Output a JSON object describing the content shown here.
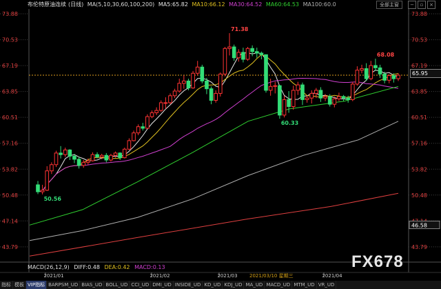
{
  "header": {
    "title": "布伦特原油连续",
    "period": "(日线)",
    "ma_label": "MA(5,10,30,60,100,200)",
    "ma5": "MA5:65.82",
    "ma10": "MA10:66.12",
    "ma30": "MA30:64.52",
    "ma60": "MA60:64.53",
    "ma100": "MA100:60.0",
    "mode_button": "全部主窗",
    "colors": {
      "ma5": "#e8e8e8",
      "ma10": "#e0c020",
      "ma30": "#d040d0",
      "ma60": "#30d030",
      "ma100": "#b0b0b0",
      "ma200": "#e04040"
    }
  },
  "price_tag": "65.95",
  "macd": {
    "label": "MACD(26,12,9)",
    "diff": "DIFF:0.48",
    "dea": "DEA:0.42",
    "macd": "MACD:0.13"
  },
  "cursor_date": "2021/03/10 星期三",
  "watermark": "FX678",
  "tabs": [
    "指标",
    "模板",
    "VIP指标",
    "BARPSM_UD",
    "BIAS_UD",
    "BOLL_UD",
    "CCI_UD",
    "DMI_UD",
    "INSIDE_UD",
    "KD_UD",
    "KDJ_UD",
    "MA_UD",
    "MACD_UD",
    "MTM_UD",
    "VR_UD"
  ],
  "chart_data": {
    "type": "candlestick",
    "symbol": "布伦特原油连续",
    "period": "日线",
    "y_ticks": [
      73.88,
      70.53,
      67.19,
      63.85,
      60.51,
      57.16,
      53.82,
      50.48,
      47.14,
      43.79
    ],
    "ylim": [
      42.0,
      74.5
    ],
    "x_labels": [
      "2021/01",
      "2021/02",
      "2021/03",
      "2021/04"
    ],
    "right_labels": [
      "65.95",
      "46.58"
    ],
    "annotations": [
      {
        "text": "71.38",
        "value": 71.38
      },
      {
        "text": "68.08",
        "value": 68.08
      },
      {
        "text": "60.33",
        "value": 60.33
      },
      {
        "text": "50.56",
        "value": 50.56
      }
    ],
    "candles": [
      [
        51.8,
        50.9,
        52.3,
        50.6
      ],
      [
        50.9,
        51.1,
        51.8,
        50.56
      ],
      [
        51.1,
        53.6,
        54.2,
        51.0
      ],
      [
        53.6,
        54.4,
        54.7,
        53.2
      ],
      [
        54.4,
        55.9,
        56.2,
        54.1
      ],
      [
        55.9,
        55.7,
        56.8,
        55.2
      ],
      [
        55.7,
        56.3,
        56.6,
        55.4
      ],
      [
        56.3,
        55.5,
        56.4,
        55.0
      ],
      [
        55.5,
        55.1,
        55.8,
        54.6
      ],
      [
        55.1,
        54.3,
        55.4,
        53.9
      ],
      [
        54.3,
        54.7,
        55.0,
        54.0
      ],
      [
        54.7,
        54.9,
        55.2,
        54.4
      ],
      [
        54.9,
        55.7,
        56.0,
        54.8
      ],
      [
        55.7,
        55.4,
        56.0,
        55.2
      ],
      [
        55.4,
        55.6,
        55.8,
        55.1
      ],
      [
        55.6,
        55.0,
        55.9,
        54.7
      ],
      [
        55.0,
        55.6,
        55.8,
        54.8
      ],
      [
        55.6,
        55.9,
        56.1,
        55.3
      ],
      [
        55.9,
        55.3,
        56.0,
        55.0
      ],
      [
        55.3,
        56.4,
        56.6,
        55.2
      ],
      [
        56.4,
        57.5,
        57.8,
        56.3
      ],
      [
        57.5,
        58.5,
        58.8,
        57.4
      ],
      [
        58.5,
        59.3,
        59.6,
        58.2
      ],
      [
        59.3,
        59.1,
        59.8,
        58.8
      ],
      [
        59.1,
        60.6,
        60.9,
        59.0
      ],
      [
        60.6,
        61.1,
        61.4,
        60.4
      ],
      [
        61.1,
        61.4,
        61.8,
        60.8
      ],
      [
        61.4,
        62.4,
        62.7,
        61.2
      ],
      [
        62.4,
        62.4,
        63.1,
        61.6
      ],
      [
        62.4,
        63.3,
        63.6,
        62.2
      ],
      [
        63.3,
        63.9,
        64.2,
        63.0
      ],
      [
        63.9,
        64.9,
        65.5,
        63.7
      ],
      [
        64.9,
        65.2,
        65.9,
        64.2
      ],
      [
        65.2,
        64.3,
        65.5,
        64.0
      ],
      [
        64.3,
        66.2,
        66.5,
        64.2
      ],
      [
        66.2,
        67.0,
        67.8,
        65.9
      ],
      [
        67.0,
        65.2,
        67.3,
        64.9
      ],
      [
        65.2,
        64.2,
        65.6,
        63.5
      ],
      [
        64.2,
        62.7,
        64.5,
        62.2
      ],
      [
        62.7,
        63.6,
        64.0,
        62.4
      ],
      [
        63.6,
        66.1,
        66.3,
        63.2
      ],
      [
        66.1,
        69.4,
        69.6,
        65.8
      ],
      [
        69.4,
        69.6,
        71.38,
        68.5
      ],
      [
        69.6,
        68.2,
        69.9,
        67.8
      ],
      [
        68.2,
        68.9,
        69.3,
        67.7
      ],
      [
        68.9,
        68.0,
        69.5,
        67.6
      ],
      [
        68.0,
        69.4,
        69.6,
        67.8
      ],
      [
        69.4,
        69.0,
        69.8,
        68.4
      ],
      [
        69.0,
        68.8,
        69.5,
        68.2
      ],
      [
        68.8,
        68.6,
        69.0,
        68.0
      ],
      [
        68.6,
        64.0,
        68.6,
        63.7
      ],
      [
        64.0,
        64.5,
        65.5,
        63.3
      ],
      [
        64.5,
        64.6,
        65.1,
        63.6
      ],
      [
        64.6,
        60.8,
        64.7,
        60.33
      ],
      [
        60.8,
        62.8,
        63.3,
        60.5
      ],
      [
        62.8,
        61.9,
        63.9,
        61.1
      ],
      [
        61.9,
        64.0,
        64.6,
        61.5
      ],
      [
        64.0,
        64.7,
        65.1,
        63.4
      ],
      [
        64.7,
        62.8,
        65.0,
        62.1
      ],
      [
        62.8,
        63.0,
        63.3,
        62.4
      ],
      [
        63.0,
        63.6,
        64.0,
        62.3
      ],
      [
        63.6,
        64.0,
        64.3,
        63.0
      ],
      [
        64.0,
        63.0,
        64.4,
        62.5
      ],
      [
        63.0,
        63.2,
        63.5,
        62.6
      ],
      [
        63.2,
        62.2,
        63.5,
        61.9
      ],
      [
        62.2,
        62.9,
        63.2,
        61.8
      ],
      [
        62.9,
        63.2,
        63.7,
        62.6
      ],
      [
        63.2,
        63.0,
        63.4,
        62.6
      ],
      [
        63.0,
        62.8,
        63.3,
        62.4
      ],
      [
        62.8,
        64.8,
        65.1,
        62.6
      ],
      [
        64.8,
        66.6,
        67.1,
        64.6
      ],
      [
        66.6,
        66.8,
        67.3,
        66.2
      ],
      [
        66.8,
        65.5,
        67.5,
        65.2
      ],
      [
        65.5,
        67.2,
        67.8,
        65.3
      ],
      [
        67.2,
        66.9,
        68.08,
        66.5
      ],
      [
        66.9,
        66.1,
        67.3,
        65.6
      ],
      [
        66.1,
        65.3,
        66.4,
        64.9
      ],
      [
        65.3,
        65.9,
        66.1,
        64.9
      ],
      [
        65.9,
        65.5,
        66.2,
        65.0
      ],
      [
        65.5,
        65.95,
        66.2,
        65.2
      ]
    ]
  }
}
